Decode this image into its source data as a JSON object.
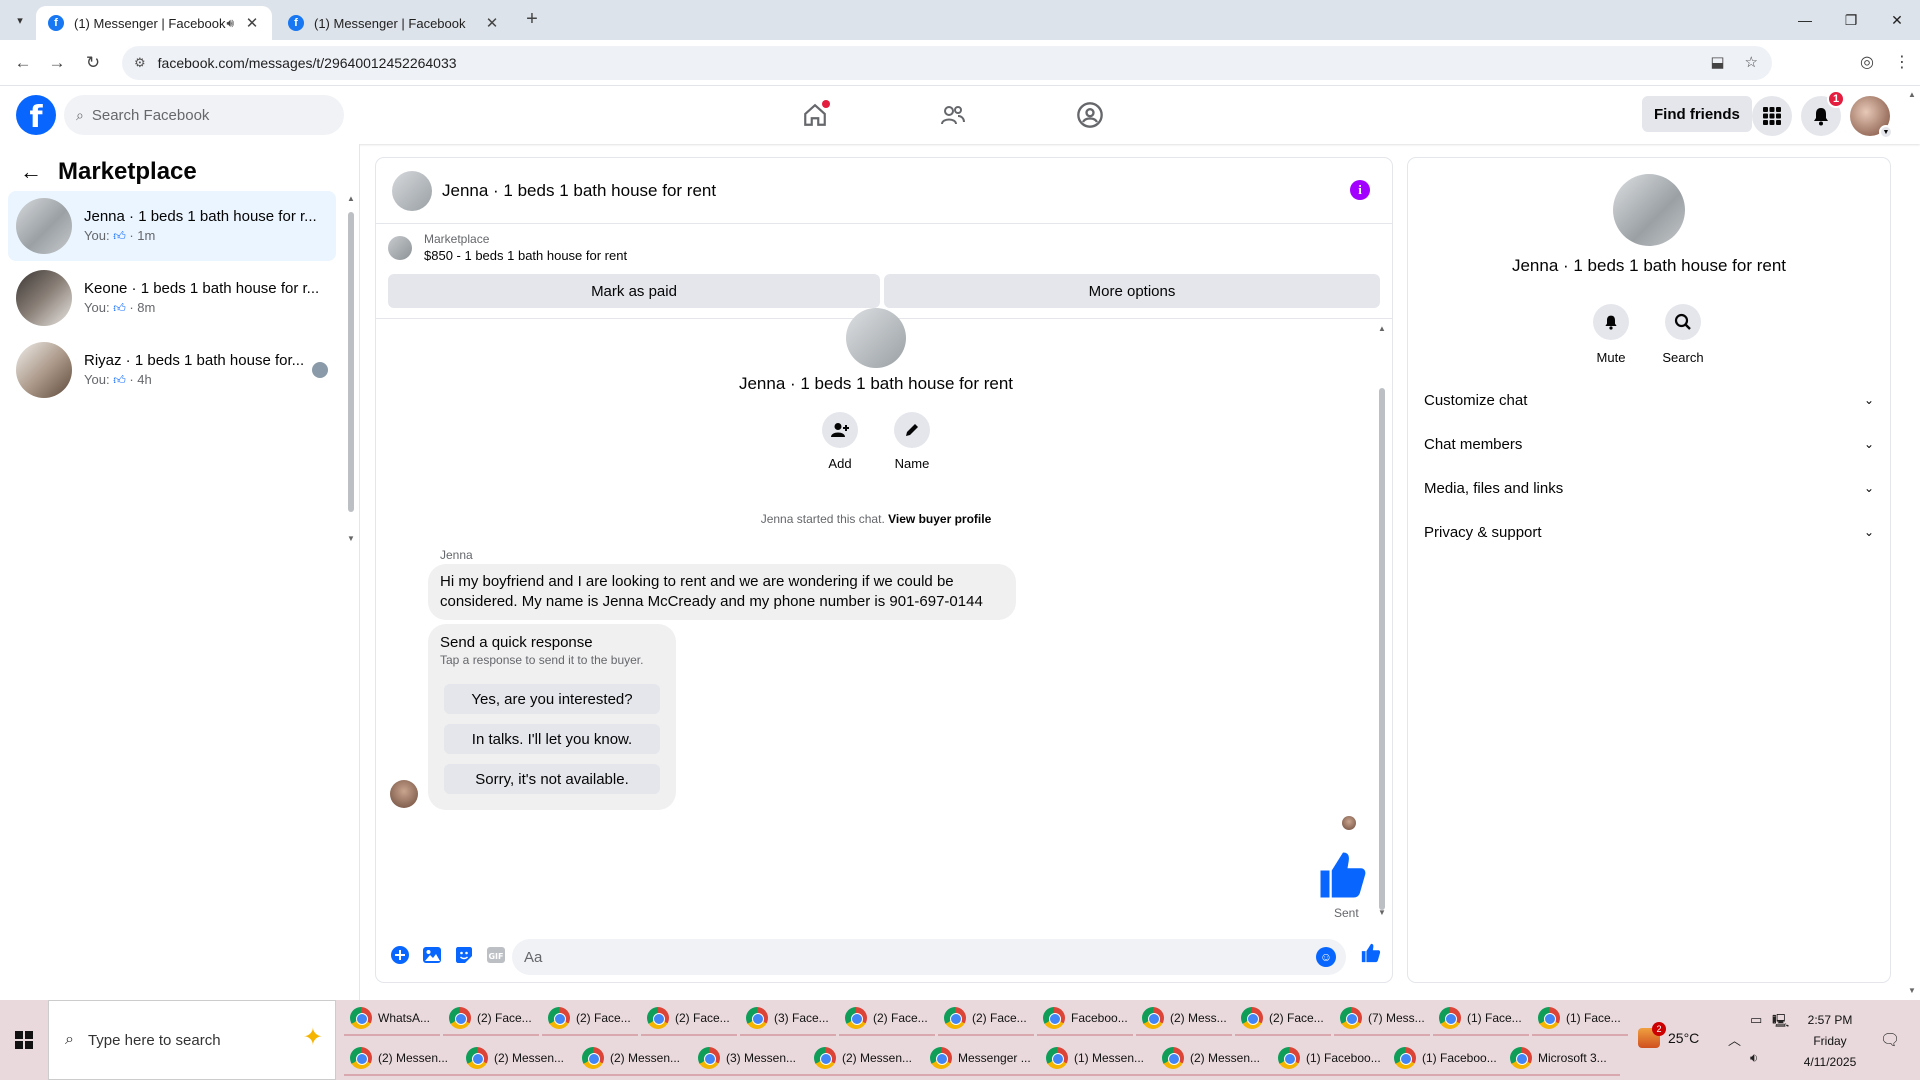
{
  "browser": {
    "tabs": [
      {
        "title": "(1) Messenger | Facebook",
        "active": true,
        "audio": true
      },
      {
        "title": "(1) Messenger | Facebook",
        "active": false,
        "audio": false
      }
    ],
    "url": "facebook.com/messages/t/29640012452264033"
  },
  "fb_header": {
    "search_placeholder": "Search Facebook",
    "find_friends": "Find friends",
    "notification_count": "1"
  },
  "sidebar": {
    "title": "Marketplace",
    "conversations": [
      {
        "title": "Jenna · 1 beds 1 bath house for r...",
        "you": "You:",
        "time": "· 1m",
        "active": true
      },
      {
        "title": "Keone · 1 beds 1 bath house for r...",
        "you": "You:",
        "time": "· 8m",
        "active": false
      },
      {
        "title": "Riyaz · 1 beds 1 bath house for...",
        "you": "You:",
        "time": "· 4h",
        "active": false
      }
    ]
  },
  "chat": {
    "title": "Jenna · 1 beds 1 bath house for rent",
    "marketplace_label": "Marketplace",
    "listing": "$850 - 1 beds 1 bath house for rent",
    "mark_as_paid": "Mark as paid",
    "more_options": "More options",
    "intro_title": "Jenna · 1 beds 1 bath house for rent",
    "add_label": "Add",
    "name_label": "Name",
    "started_text": "Jenna started this chat.",
    "view_profile": "View buyer profile",
    "sender": "Jenna",
    "message": "Hi my boyfriend and I are looking to rent and we are wondering if we could be considered. My name is Jenna McCready and my phone number is 901-697-0144",
    "quick_title": "Send a quick response",
    "quick_sub": "Tap a response to send it to the buyer.",
    "quick_responses": [
      "Yes, are you interested?",
      "In talks. I'll let you know.",
      "Sorry, it's not available."
    ],
    "sent_label": "Sent",
    "composer_placeholder": "Aa"
  },
  "details": {
    "title": "Jenna · 1 beds 1 bath house for rent",
    "mute": "Mute",
    "search": "Search",
    "sections": [
      "Customize chat",
      "Chat members",
      "Media, files and links",
      "Privacy & support"
    ]
  },
  "taskbar": {
    "search_placeholder": "Type here to search",
    "row1": [
      "WhatsA...",
      "(2) Face...",
      "(2) Face...",
      "(2) Face...",
      "(3) Face...",
      "(2) Face...",
      "(2) Face...",
      "Faceboo...",
      "(2) Mess...",
      "(2) Face...",
      "(7) Mess...",
      "(1) Face...",
      "(1) Face..."
    ],
    "row2": [
      "(2) Messen...",
      "(2) Messen...",
      "(2) Messen...",
      "(3) Messen...",
      "(2) Messen...",
      "Messenger ...",
      "(1) Messen...",
      "(2) Messen...",
      "(1) Faceboo...",
      "(1) Faceboo...",
      "Microsoft 3..."
    ],
    "weather": "25°C",
    "weather_badge": "2",
    "time": "2:57 PM",
    "day": "Friday",
    "date": "4/11/2025"
  },
  "colors": {
    "fb_blue": "#0866ff",
    "info_purple": "#a200ff",
    "active_row": "#ebf5ff",
    "taskbar": "#e9d9dc"
  }
}
